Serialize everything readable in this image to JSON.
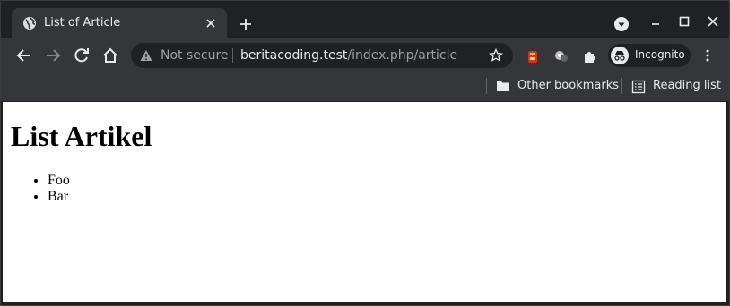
{
  "browser": {
    "tab": {
      "title": "List of Article"
    },
    "address": {
      "security_label": "Not secure",
      "host": "beritacoding.test",
      "path": "/index.php/article"
    },
    "profile": {
      "label": "Incognito"
    },
    "bookmarks": [
      {
        "label": "Other bookmarks",
        "icon": "folder-icon"
      },
      {
        "label": "Reading list",
        "icon": "reading-list-icon"
      }
    ]
  },
  "page": {
    "heading": "List Artikel",
    "items": [
      "Foo",
      "Bar"
    ]
  }
}
